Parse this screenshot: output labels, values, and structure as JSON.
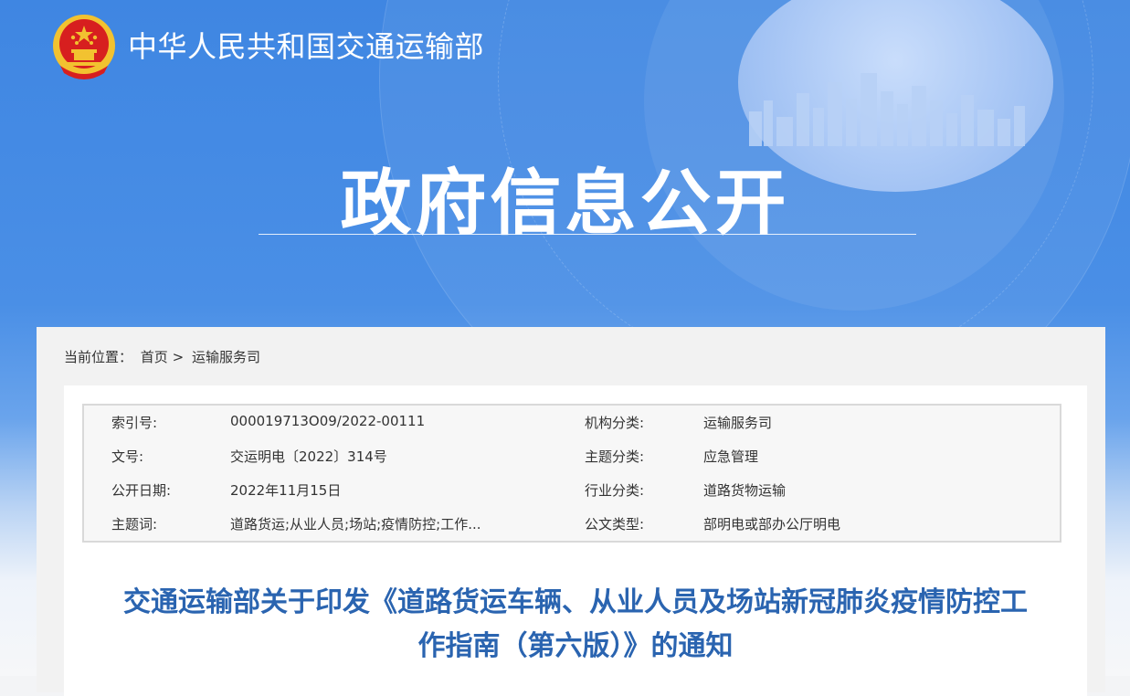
{
  "header": {
    "ministry_name": "中华人民共和国交通运输部",
    "section_title": "政府信息公开"
  },
  "breadcrumb": {
    "prefix": "当前位置：",
    "items": [
      "首页",
      "运输服务司"
    ],
    "separator": ">"
  },
  "meta": {
    "rows": [
      {
        "k1": "索引号:",
        "v1": "000019713O09/2022-00111",
        "k2": "机构分类:",
        "v2": "运输服务司"
      },
      {
        "k1": "文号:",
        "v1": "交运明电〔2022〕314号",
        "k2": "主题分类:",
        "v2": "应急管理"
      },
      {
        "k1": "公开日期:",
        "v1": "2022年11月15日",
        "k2": "行业分类:",
        "v2": "道路货物运输"
      },
      {
        "k1": "主题词:",
        "v1": "道路货运;从业人员;场站;疫情防控;工作...",
        "k2": "公文类型:",
        "v2": "部明电或部办公厅明电"
      }
    ]
  },
  "document": {
    "title_line1": "交通运输部关于印发《道路货运车辆、从业人员及场站新冠肺炎疫情防控工",
    "title_line2": "作指南（第六版）》的通知"
  },
  "colors": {
    "banner_blue": "#3f86e2",
    "title_blue": "#2a64b0",
    "emblem_red": "#d71f1f",
    "emblem_gold": "#f2c230"
  }
}
